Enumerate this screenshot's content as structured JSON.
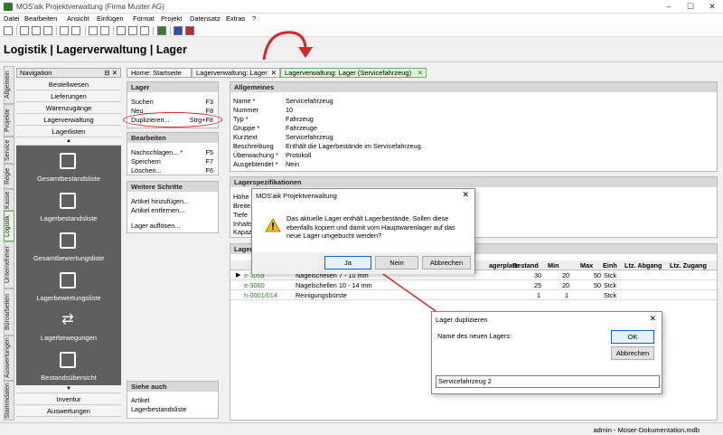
{
  "window": {
    "title": "MOS'aik Projektverwaltung (Firma Muster AG)",
    "min": "–",
    "max": "☐",
    "close": "✕"
  },
  "menu": [
    "Datei",
    "Bearbeiten",
    "Ansicht",
    "Einfügen",
    "Format",
    "Projekt",
    "Datensatz",
    "Extras",
    "?"
  ],
  "heading": "Logistik | Lagerverwaltung | Lager",
  "vtabs": [
    "Allgemein",
    "Projekte",
    "Service",
    "Regie",
    "Kasse",
    "Logistik",
    "Unternehmer",
    "Büroarbeiten",
    "Auswertungen",
    "Stammdaten"
  ],
  "nav": {
    "header": "Navigation",
    "pin": "⊟ ✕",
    "items": [
      "Bestellwesen",
      "Lieferungen",
      "Warenzugänge",
      "Lagerverwaltung",
      "Lagerlisten"
    ],
    "big": [
      "Gesamtbestandsliste",
      "Lagerbestandsliste",
      "Gesamtbewertungsliste",
      "Lagerbewertungsliste",
      "Lagerbewegungen",
      "Bestandsübersicht"
    ],
    "bottom": [
      "Inventur",
      "Auswertungen"
    ],
    "up": "▲",
    "down": "▼"
  },
  "tabs": [
    {
      "label": "Home: Startseite"
    },
    {
      "label": "Lagerverwaltung: Lager",
      "close": "✕"
    },
    {
      "label": "Lagerverwaltung: Lager (Servicefahrzeug)",
      "close": "✕"
    }
  ],
  "actions": {
    "lager": {
      "title": "Lager",
      "rows": [
        [
          "Suchen",
          "F3"
        ],
        [
          "Neu",
          "F8"
        ],
        [
          "Duplizieren...",
          "Strg+F8"
        ]
      ]
    },
    "bearbeiten": {
      "title": "Bearbeiten",
      "rows": [
        [
          "Nachschlagen... *",
          "F5"
        ],
        [
          "Speichern",
          "F7"
        ],
        [
          "Löschen...",
          "F6"
        ]
      ]
    },
    "weitere": {
      "title": "Weitere Schritte",
      "rows": [
        "Artikel hinzufügen...",
        "Artikel entfernen...",
        "Lager auflösen..."
      ]
    },
    "siehe": {
      "title": "Siehe auch",
      "rows": [
        "Artikel",
        "Lagerbestandsliste"
      ]
    }
  },
  "allgemein": {
    "title": "Allgemeines",
    "fields": [
      [
        "Name *",
        "Servicefahrzeug"
      ],
      [
        "Nummer",
        "10"
      ],
      [
        "Typ *",
        "Fahrzeug"
      ],
      [
        "Gruppe *",
        "Fahrzeuge"
      ],
      [
        "Kurztext",
        "Servicefahrzeug"
      ],
      [
        "Beschreibung",
        "Enthält die Lagerbestände im Servicefahrzeug."
      ],
      [
        "Überwachung *",
        "Protokoll"
      ],
      [
        "Ausgeblendet *",
        "Nein"
      ]
    ]
  },
  "spez": {
    "title": "Lagerspezifikationen",
    "labels": [
      "Höhe",
      "Breite",
      "Tiefe",
      "Inhalts",
      "Kapazit"
    ]
  },
  "grid": {
    "title": "Lagerb",
    "cols": [
      "agerplatz",
      "Bestand",
      "Min",
      "Max",
      "Einh",
      "Ltz. Abgang",
      "Ltz. Zugang"
    ],
    "rows": [
      {
        "nr": "e-3059",
        "name": "Nagelschellen 7 - 10 mm",
        "bestand": "30",
        "min": "20",
        "max": "50",
        "einh": "Stck"
      },
      {
        "nr": "e-3060",
        "name": "Nagelschellen 10 - 14 mm",
        "bestand": "25",
        "min": "20",
        "max": "50",
        "einh": "Stck"
      },
      {
        "nr": "h-0001/014",
        "name": "Reinigungsbürste",
        "bestand": "1",
        "min": "1",
        "max": "",
        "einh": "Stck"
      }
    ]
  },
  "dialog1": {
    "title": "MOS'aik Projektverwaltung",
    "message": "Das aktuelle Lager enthält Lagerbestände. Sollen diese ebenfalls kopiert und damit vom Hauptwarenlager auf das neue Lager umgebucht werden?",
    "yes": "Ja",
    "no": "Nein",
    "cancel": "Abbrechen",
    "close": "✕"
  },
  "dialog2": {
    "title": "Lager duplizieren",
    "label": "Name des neuen Lagers:",
    "ok": "OK",
    "cancel": "Abbrechen",
    "value": "Servicefahrzeug 2",
    "close": "✕"
  },
  "status": "admin - Moser-Dokumentation.mdb",
  "colors": {
    "accent_red": "#d9262a",
    "active_tab": "#e8f7e4",
    "green_text": "#2e7d2e"
  }
}
